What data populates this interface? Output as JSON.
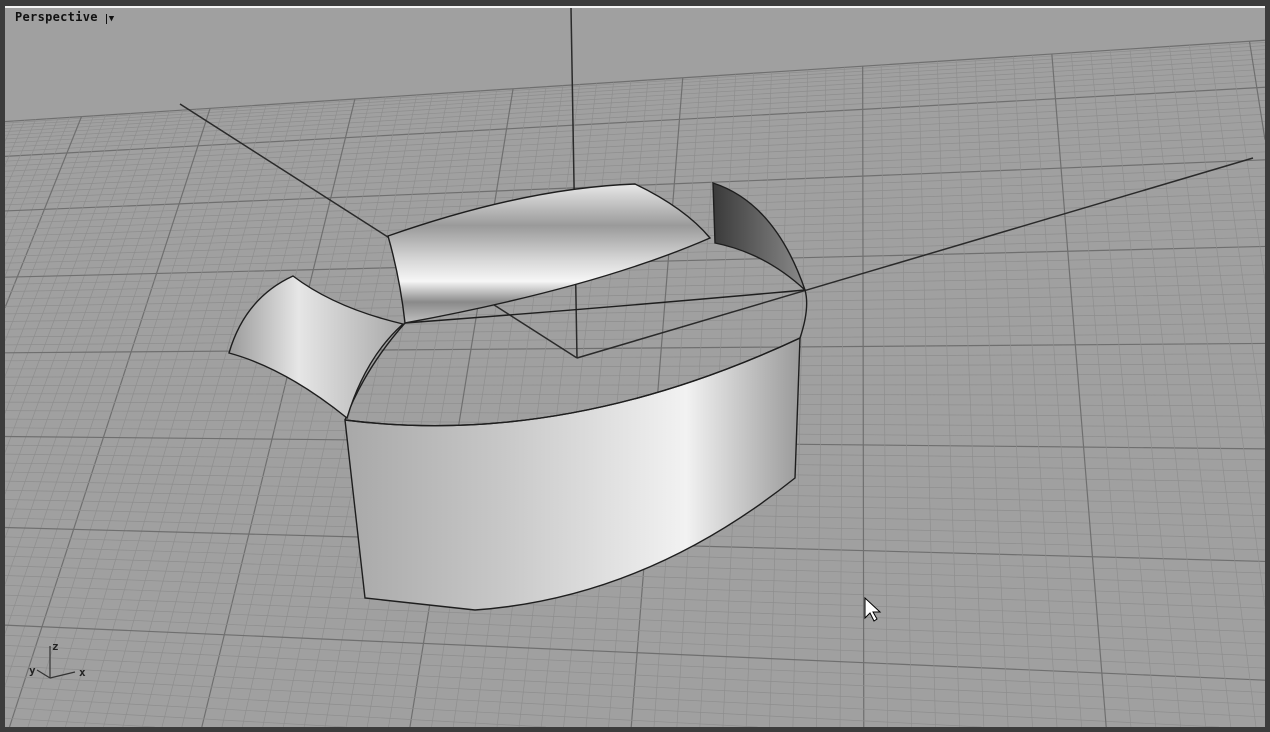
{
  "viewport": {
    "title": "Perspective",
    "menu_icon": "dropdown-arrow-icon"
  },
  "axis_widget": {
    "x": "x",
    "y": "y",
    "z": "z"
  },
  "colors": {
    "background": "#a0a0a0",
    "grid_minor": "#8e8e8e",
    "grid_major": "#6f6f6f",
    "axis": "#2a2a2a",
    "frame": "#3c3c3c"
  }
}
